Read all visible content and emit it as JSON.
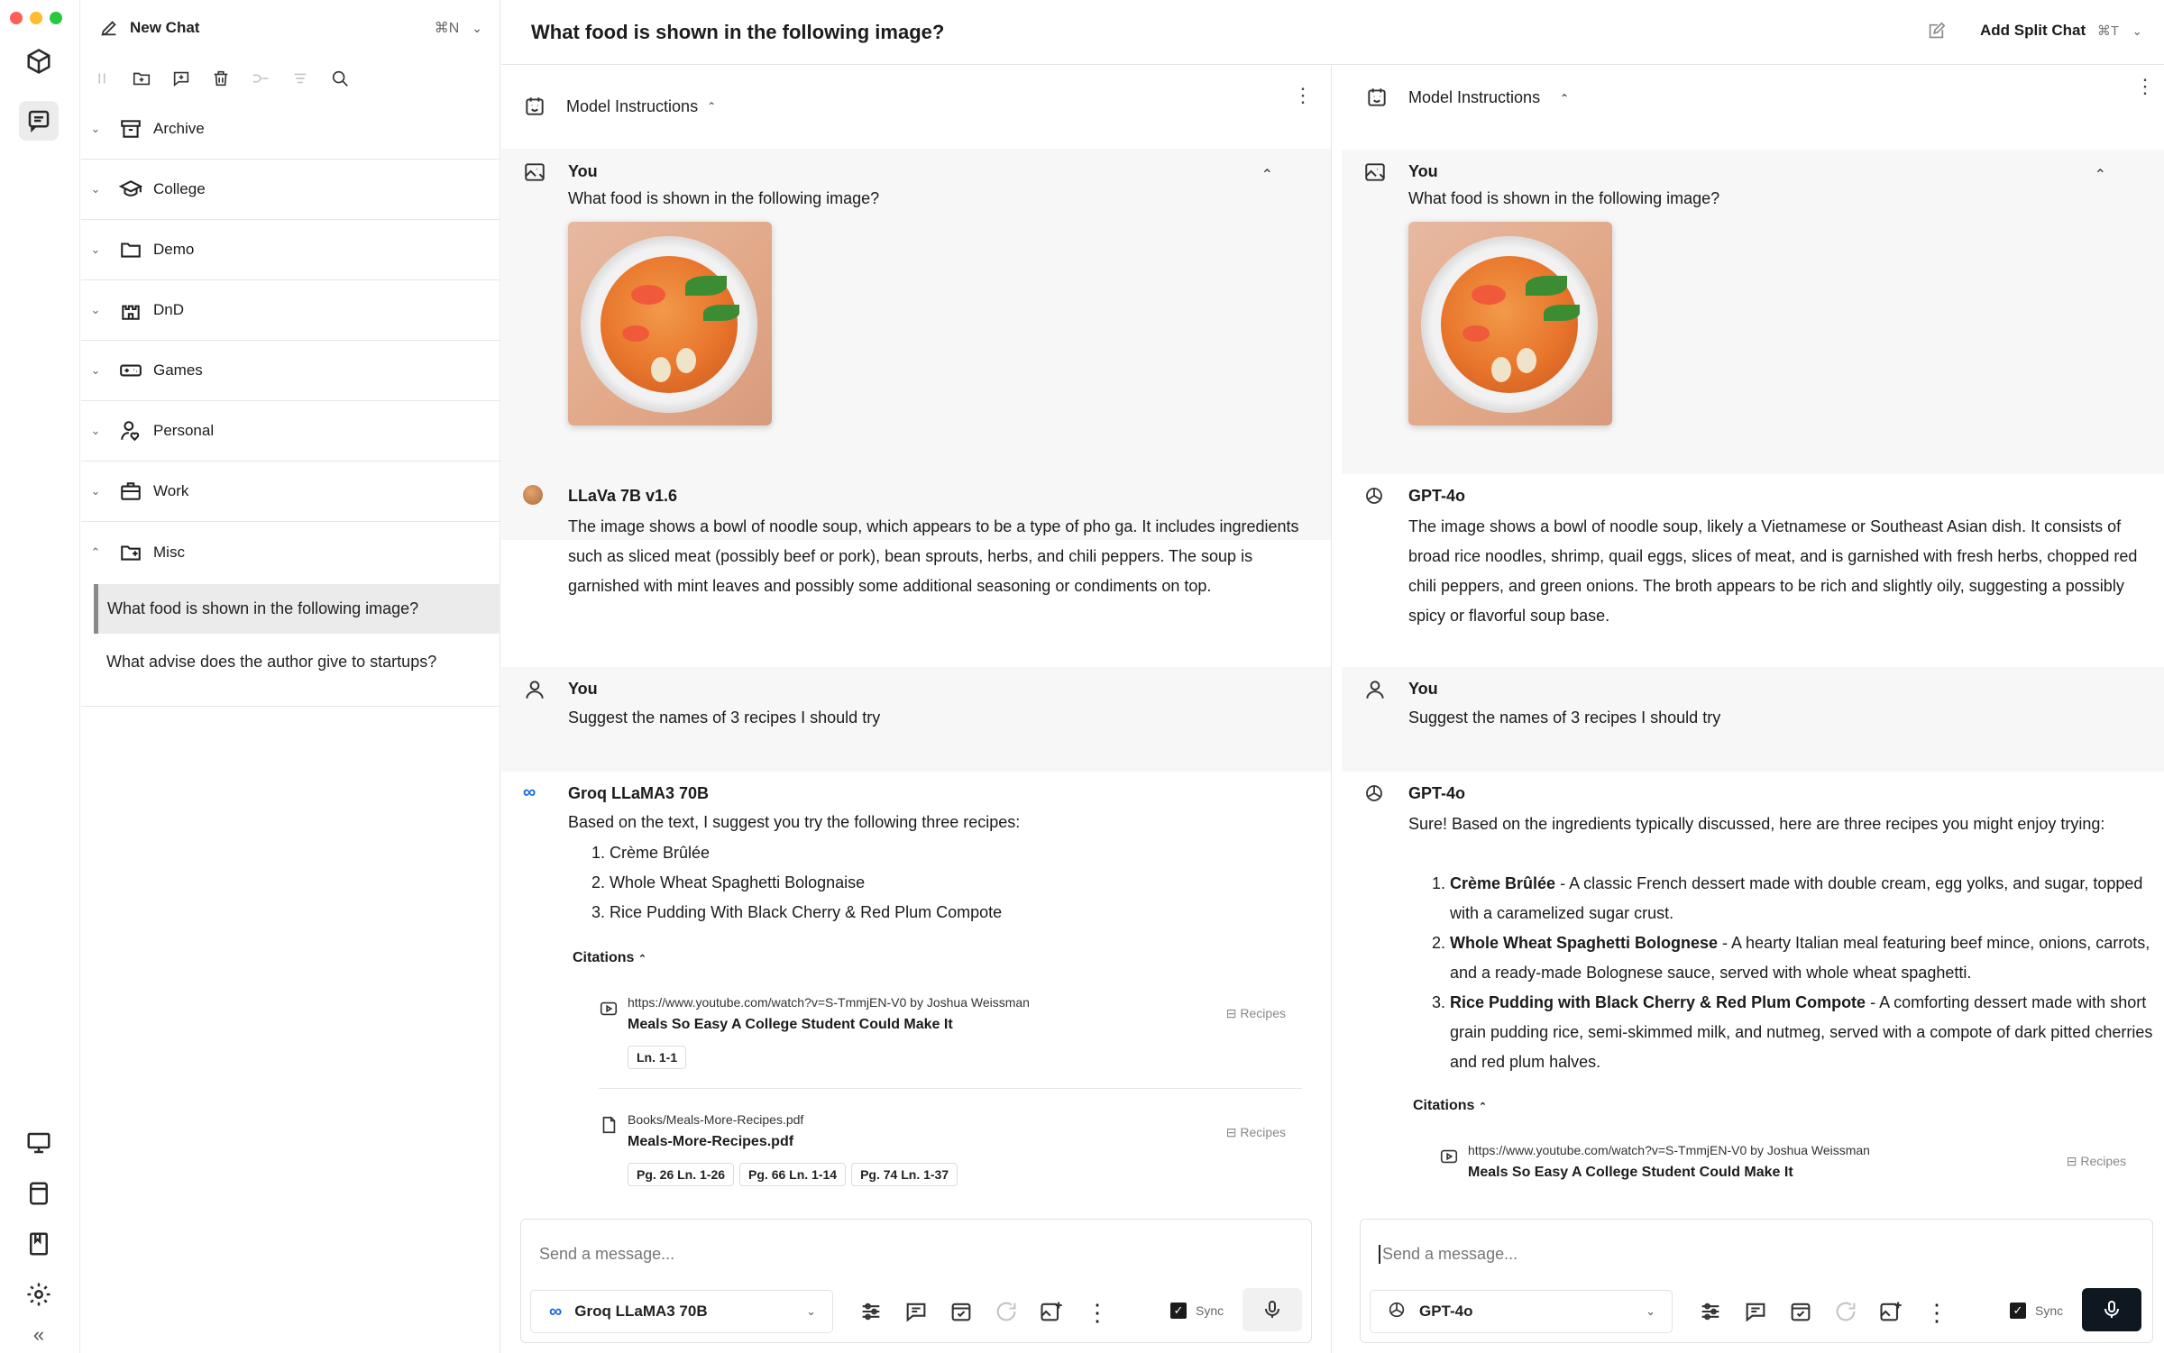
{
  "app": {
    "window_title": "What food is shown in the following image?",
    "add_split_chat": "Add Split Chat",
    "add_split_shortcut": "⌘T"
  },
  "sidebar": {
    "new_chat": "New Chat",
    "new_chat_shortcut": "⌘N",
    "folders": [
      {
        "label": "Archive",
        "icon": "archive-icon"
      },
      {
        "label": "College",
        "icon": "graduation-cap-icon"
      },
      {
        "label": "Demo",
        "icon": "folder-icon"
      },
      {
        "label": "DnD",
        "icon": "castle-icon"
      },
      {
        "label": "Games",
        "icon": "gamepad-icon"
      },
      {
        "label": "Personal",
        "icon": "person-heart-icon"
      },
      {
        "label": "Work",
        "icon": "briefcase-icon"
      },
      {
        "label": "Misc",
        "icon": "folder-open-icon"
      }
    ],
    "chats": [
      {
        "label": "What food is shown in the following image?",
        "active": true
      },
      {
        "label": "What advise does the author give to startups?",
        "active": false
      }
    ]
  },
  "left_pane": {
    "model_instructions": "Model Instructions",
    "user_label": "You",
    "question1": "What food is shown in the following image?",
    "bot1_name": "LLaVa 7B v1.6",
    "bot1_text": "The image shows a bowl of noodle soup, which appears to be a type of pho ga. It includes ingredients such as sliced meat (possibly beef or pork), bean sprouts, herbs, and chili peppers. The soup is garnished with mint leaves and possibly some additional seasoning or condiments on top.",
    "question2": "Suggest the names of 3 recipes I should try",
    "bot2_name": "Groq LLaMA3 70B",
    "bot2_intro": "Based on the text, I suggest you try the following three recipes:",
    "recipes": [
      "Crème Brûlée",
      "Whole Wheat Spaghetti Bolognaise",
      "Rice Pudding With Black Cherry & Red Plum Compote"
    ],
    "citations_label": "Citations",
    "citations": [
      {
        "url": "https://www.youtube.com/watch?v=S-TmmjEN-V0 by Joshua Weissman",
        "name": "Meals So Easy A College Student Could Make It",
        "tag": "Recipes",
        "chips": [
          "Ln. 1-1"
        ]
      },
      {
        "url": "Books/Meals-More-Recipes.pdf",
        "name": "Meals-More-Recipes.pdf",
        "tag": "Recipes",
        "chips": [
          "Pg. 26  Ln. 1-26",
          "Pg. 66  Ln. 1-14",
          "Pg. 74  Ln. 1-37"
        ]
      }
    ],
    "composer": {
      "placeholder": "Send a message...",
      "model": "Groq LLaMA3 70B",
      "sync": "Sync"
    }
  },
  "right_pane": {
    "model_instructions": "Model Instructions",
    "user_label": "You",
    "question1": "What food is shown in the following image?",
    "bot1_name": "GPT-4o",
    "bot1_text": "The image shows a bowl of noodle soup, likely a Vietnamese or Southeast Asian dish. It consists of broad rice noodles, shrimp, quail eggs, slices of meat, and is garnished with fresh herbs, chopped red chili peppers, and green onions. The broth appears to be rich and slightly oily, suggesting a possibly spicy or flavorful soup base.",
    "question2": "Suggest the names of 3 recipes I should try",
    "bot2_name": "GPT-4o",
    "bot2_intro": "Sure! Based on the ingredients typically discussed, here are three recipes you might enjoy trying:",
    "recipes": [
      {
        "title": "Crème Brûlée",
        "desc": " - A classic French dessert made with double cream, egg yolks, and sugar, topped with a caramelized sugar crust."
      },
      {
        "title": "Whole Wheat Spaghetti Bolognese",
        "desc": " - A hearty Italian meal featuring beef mince, onions, carrots, and a ready-made Bolognese sauce, served with whole wheat spaghetti."
      },
      {
        "title": "Rice Pudding with Black Cherry & Red Plum Compote",
        "desc": " - A comforting dessert made with short grain pudding rice, semi-skimmed milk, and nutmeg, served with a compote of dark pitted cherries and red plum halves."
      }
    ],
    "citations_label": "Citations",
    "citation": {
      "url": "https://www.youtube.com/watch?v=S-TmmjEN-V0 by Joshua Weissman",
      "name": "Meals So Easy A College Student Could Make It",
      "tag": "Recipes"
    },
    "composer": {
      "placeholder": "Send a message...",
      "model": "GPT-4o",
      "sync": "Sync"
    }
  },
  "colors": {
    "accent_dark": "#0f1720",
    "active_item": "#ebebeb",
    "user_bg": "#f7f7f7"
  }
}
